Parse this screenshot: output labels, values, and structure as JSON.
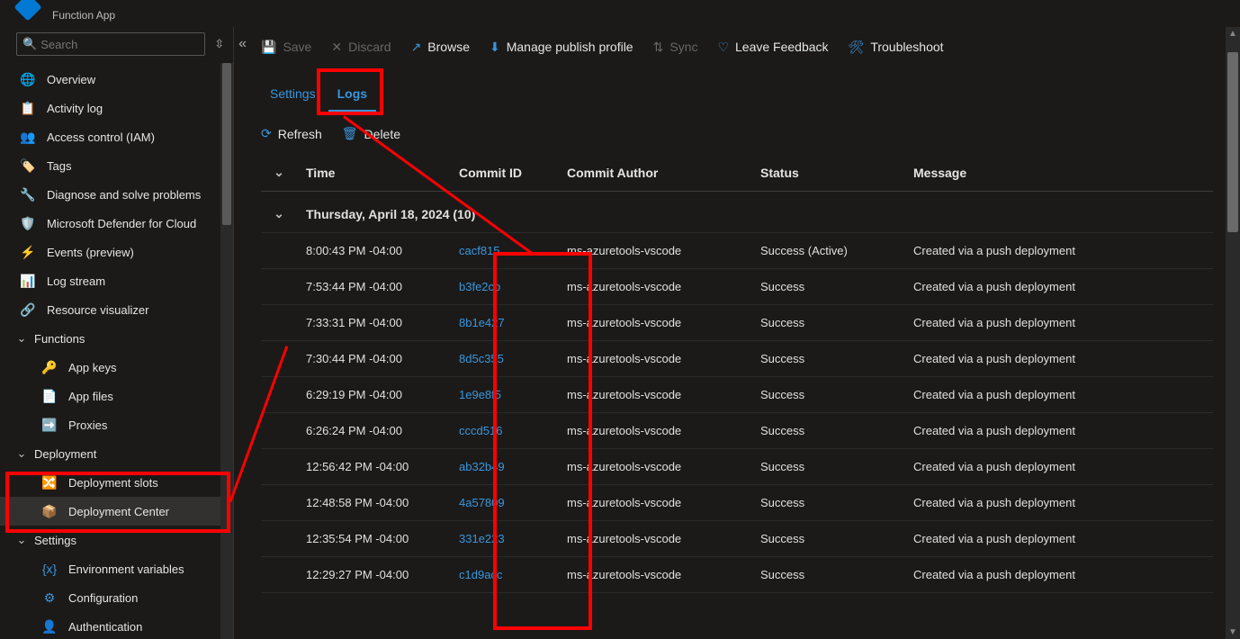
{
  "header": {
    "subtitle": "Function App"
  },
  "search": {
    "placeholder": "Search"
  },
  "sidebar": {
    "items": [
      {
        "icon": "🌐",
        "label": "Overview",
        "color": "#f2c811"
      },
      {
        "icon": "📋",
        "label": "Activity log",
        "color": "#3a96dd"
      },
      {
        "icon": "👥",
        "label": "Access control (IAM)",
        "color": "#3a96dd"
      },
      {
        "icon": "🏷️",
        "label": "Tags",
        "color": "#a864cd"
      },
      {
        "icon": "🔧",
        "label": "Diagnose and solve problems",
        "color": "#ccc"
      },
      {
        "icon": "🛡️",
        "label": "Microsoft Defender for Cloud",
        "color": "#3a96dd"
      },
      {
        "icon": "⚡",
        "label": "Events (preview)",
        "color": "#f2c811"
      },
      {
        "icon": "📊",
        "label": "Log stream",
        "color": "#e8825d"
      },
      {
        "icon": "🔗",
        "label": "Resource visualizer",
        "color": "#ccc"
      }
    ],
    "sections": [
      {
        "label": "Functions",
        "children": [
          {
            "icon": "🔑",
            "label": "App keys",
            "color": "#f2c811"
          },
          {
            "icon": "📄",
            "label": "App files",
            "color": "#3a96dd"
          },
          {
            "icon": "➡️",
            "label": "Proxies",
            "color": "#2a8a4a"
          }
        ]
      },
      {
        "label": "Deployment",
        "children": [
          {
            "icon": "🔀",
            "label": "Deployment slots",
            "color": "#3a96dd"
          },
          {
            "icon": "📦",
            "label": "Deployment Center",
            "color": "#3a96dd",
            "selected": true
          }
        ]
      },
      {
        "label": "Settings",
        "children": [
          {
            "icon": "{x}",
            "label": "Environment variables",
            "color": "#3a96dd"
          },
          {
            "icon": "⚙",
            "label": "Configuration",
            "color": "#3a96dd"
          },
          {
            "icon": "👤",
            "label": "Authentication",
            "color": "#3a96dd"
          }
        ]
      }
    ]
  },
  "cmdbar": {
    "save": "Save",
    "discard": "Discard",
    "browse": "Browse",
    "manage": "Manage publish profile",
    "sync": "Sync",
    "feedback": "Leave Feedback",
    "troubleshoot": "Troubleshoot"
  },
  "tabs": {
    "settings": "Settings",
    "logs": "Logs"
  },
  "subcmd": {
    "refresh": "Refresh",
    "delete": "Delete"
  },
  "table": {
    "headers": {
      "time": "Time",
      "commit": "Commit ID",
      "author": "Commit Author",
      "status": "Status",
      "message": "Message"
    },
    "group": "Thursday, April 18, 2024 (10)",
    "rows": [
      {
        "time": "8:00:43 PM -04:00",
        "commit": "cacf815",
        "author": "ms-azuretools-vscode",
        "status": "Success (Active)",
        "message": "Created via a push deployment"
      },
      {
        "time": "7:53:44 PM -04:00",
        "commit": "b3fe2cb",
        "author": "ms-azuretools-vscode",
        "status": "Success",
        "message": "Created via a push deployment"
      },
      {
        "time": "7:33:31 PM -04:00",
        "commit": "8b1e427",
        "author": "ms-azuretools-vscode",
        "status": "Success",
        "message": "Created via a push deployment"
      },
      {
        "time": "7:30:44 PM -04:00",
        "commit": "8d5c355",
        "author": "ms-azuretools-vscode",
        "status": "Success",
        "message": "Created via a push deployment"
      },
      {
        "time": "6:29:19 PM -04:00",
        "commit": "1e9e8f5",
        "author": "ms-azuretools-vscode",
        "status": "Success",
        "message": "Created via a push deployment"
      },
      {
        "time": "6:26:24 PM -04:00",
        "commit": "cccd516",
        "author": "ms-azuretools-vscode",
        "status": "Success",
        "message": "Created via a push deployment"
      },
      {
        "time": "12:56:42 PM -04:00",
        "commit": "ab32b49",
        "author": "ms-azuretools-vscode",
        "status": "Success",
        "message": "Created via a push deployment"
      },
      {
        "time": "12:48:58 PM -04:00",
        "commit": "4a57809",
        "author": "ms-azuretools-vscode",
        "status": "Success",
        "message": "Created via a push deployment"
      },
      {
        "time": "12:35:54 PM -04:00",
        "commit": "331e223",
        "author": "ms-azuretools-vscode",
        "status": "Success",
        "message": "Created via a push deployment"
      },
      {
        "time": "12:29:27 PM -04:00",
        "commit": "c1d9acc",
        "author": "ms-azuretools-vscode",
        "status": "Success",
        "message": "Created via a push deployment"
      }
    ]
  }
}
